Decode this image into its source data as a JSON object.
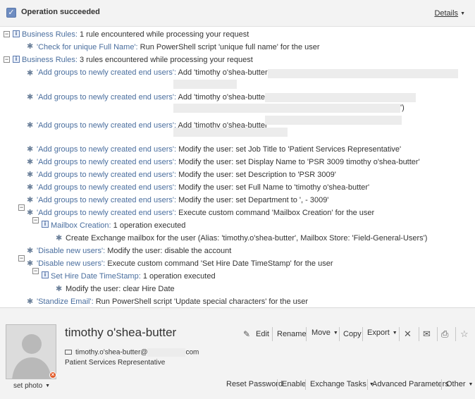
{
  "header": {
    "title": "Operation succeeded",
    "details_label": "Details",
    "check_glyph": "✓"
  },
  "log": {
    "br1_label": "Business Rules:",
    "br1_text": "1 rule encountered while processing your request",
    "r1_name": "'Check for unique Full Name':",
    "r1_text": "Run PowerShell script 'unique full name' for the user",
    "br2_label": "Business Rules:",
    "br2_text": "3 rules encountered while processing your request",
    "a1_name": "'Add groups to newly created end users':",
    "a1_text": "Add 'timothy o'shea-butter (",
    "a2_name": "'Add groups to newly created end users':",
    "a2_text": "Add 'timothy o'shea-butter",
    "a2_tail": "')",
    "a3_name": "'Add groups to newly created end users':",
    "a3_text": "Add 'timothy o'shea-butter",
    "m1_name": "'Add groups to newly created end users':",
    "m1_text": "Modify the user: set Job Title to 'Patient Services Representative'",
    "m2_name": "'Add groups to newly created end users':",
    "m2_text": "Modify the user: set Display Name to 'PSR 3009 timothy o'shea-butter'",
    "m3_name": "'Add groups to newly created end users':",
    "m3_text": "Modify the user: set Description to 'PSR 3009'",
    "m4_name": "'Add groups to newly created end users':",
    "m4_text": "Modify the user: set Full Name to 'timothy o'shea-butter'",
    "m5_name": "'Add groups to newly created end users':",
    "m5_text": "Modify the user: set Department to ', - 3009'",
    "e1_name": "'Add groups to newly created end users':",
    "e1_text": "Execute custom command 'Mailbox Creation' for the user",
    "mc_label": "Mailbox Creation:",
    "mc_text": "1 operation executed",
    "mc_child": "Create Exchange mailbox for the user (Alias: 'timothy.o'shea-butter', Mailbox Store: 'Field-General-Users')",
    "d1_name": "'Disable new users':",
    "d1_text": "Modify the user: disable the account",
    "d2_name": "'Disable new users':",
    "d2_text": "Execute custom command 'Set Hire Date TimeStamp' for the user",
    "sh_label": "Set Hire Date TimeStamp:",
    "sh_text": "1 operation executed",
    "sh_child": "Modify the user: clear Hire Date",
    "s1_name": "'Standize Email':",
    "s1_text": "Run PowerShell script 'Update special characters' for the user"
  },
  "icons": {
    "collapse": "−",
    "info": "i",
    "gear": "✱"
  },
  "card": {
    "name": "timothy o'shea-butter",
    "email_prefix": "timothy.o'shea-butter@",
    "email_suffix": "com",
    "job_title": "Patient Services Representative",
    "set_photo": "set photo",
    "badge_glyph": "×",
    "toolbar": {
      "edit": "Edit",
      "rename": "Rename",
      "move": "Move",
      "copy": "Copy",
      "export": "Export",
      "delete_glyph": "✕",
      "email_glyph": "✉",
      "print_glyph": "⎙",
      "star_glyph": "☆"
    },
    "bottom": {
      "reset_password": "Reset Password",
      "enable": "Enable",
      "exchange_tasks": "Exchange Tasks",
      "advanced_parameters": "Advanced Parameters",
      "other": "Other"
    }
  }
}
